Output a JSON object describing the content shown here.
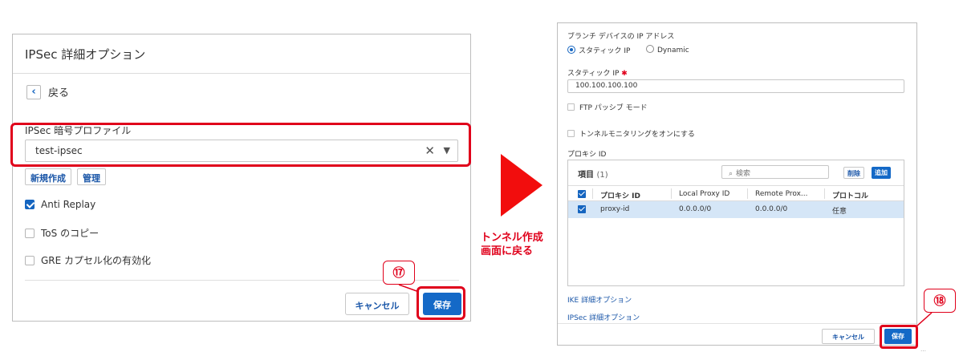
{
  "left_panel": {
    "title": "IPSec 詳細オプション",
    "back_label": "戻る",
    "profile_label": "IPSec 暗号プロファイル",
    "profile_value": "test-ipsec",
    "new_label": "新規作成",
    "manage_label": "管理",
    "options": [
      {
        "label": "Anti Replay",
        "checked": true
      },
      {
        "label": "ToS のコピー",
        "checked": false
      },
      {
        "label": "GRE カプセル化の有効化",
        "checked": false
      }
    ],
    "cancel_label": "キャンセル",
    "save_label": "保存",
    "callout": "⑰"
  },
  "arrow": {
    "line1": "トンネル作成",
    "line2": "画面に戻る"
  },
  "right_panel": {
    "branch_ip_label": "ブランチ デバイスの IP アドレス",
    "radio_static": "スタティック IP",
    "radio_dynamic": "Dynamic",
    "static_ip_label": "スタティック IP",
    "required_mark": "✱",
    "static_ip_value": "100.100.100.100",
    "ftp_label": "FTP パッシブ モード",
    "tunnel_mon_label": "トンネルモニタリングをオンにする",
    "proxy_label": "プロキシ ID",
    "table": {
      "title": "項目",
      "count": "(1)",
      "search_placeholder": "検索",
      "delete_label": "削除",
      "add_label": "追加",
      "headers": [
        "プロキシ ID",
        "Local Proxy ID",
        "Remote Prox...",
        "プロトコル"
      ],
      "rows": [
        [
          "proxy-id",
          "0.0.0.0/0",
          "0.0.0.0/0",
          "任意"
        ]
      ]
    },
    "ike_link": "IKE 詳細オプション",
    "ipsec_link": "IPSec 詳細オプション",
    "cancel_label": "キャンセル",
    "save_label": "保存",
    "callout": "⑱"
  },
  "colors": {
    "accent": "#1469c7",
    "highlight": "#e0001b",
    "selected_row": "#d5e6f7"
  }
}
